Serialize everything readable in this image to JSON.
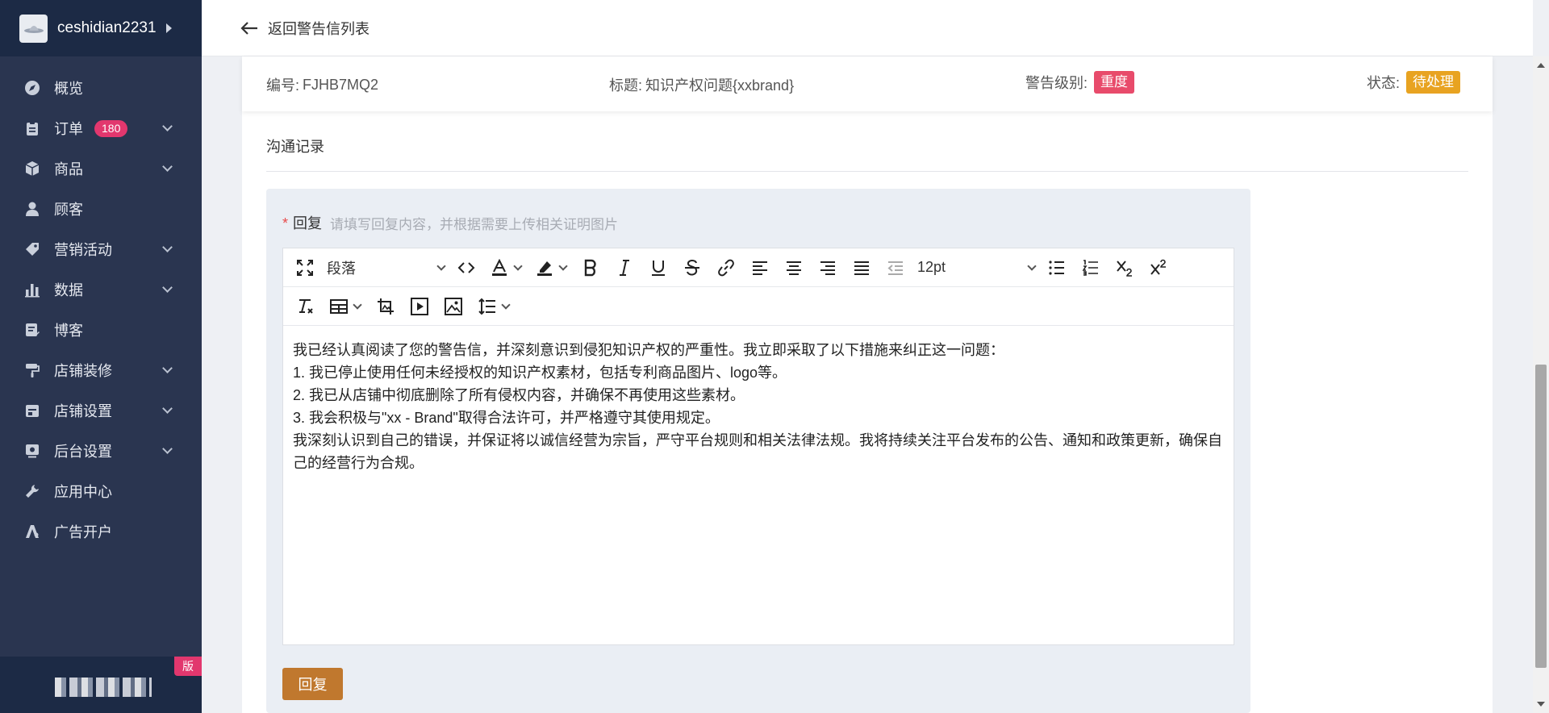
{
  "sidebar": {
    "username": "ceshidian2231",
    "version_tag": "版",
    "items": [
      {
        "label": "概览",
        "has_children": false
      },
      {
        "label": "订单",
        "has_children": true,
        "badge": "180"
      },
      {
        "label": "商品",
        "has_children": true
      },
      {
        "label": "顾客",
        "has_children": false
      },
      {
        "label": "营销活动",
        "has_children": true
      },
      {
        "label": "数据",
        "has_children": true
      },
      {
        "label": "博客",
        "has_children": false
      },
      {
        "label": "店铺装修",
        "has_children": true
      },
      {
        "label": "店铺设置",
        "has_children": true
      },
      {
        "label": "后台设置",
        "has_children": true
      },
      {
        "label": "应用中心",
        "has_children": false
      },
      {
        "label": "广告开户",
        "has_children": false
      }
    ]
  },
  "topbar": {
    "back_label": "返回警告信列表"
  },
  "info": {
    "code_label": "编号:",
    "code_value": "FJHB7MQ2",
    "title_label": "标题:",
    "title_value": "知识产权问题{xxbrand}",
    "level_label": "警告级别:",
    "level_value": "重度",
    "status_label": "状态:",
    "status_value": "待处理"
  },
  "section": {
    "title": "沟通记录"
  },
  "reply": {
    "label": "回复",
    "required_mark": "*",
    "hint": "请填写回复内容，并根据需要上传相关证明图片",
    "paragraph_select": "段落",
    "font_size_select": "12pt",
    "content_lines": [
      "我已经认真阅读了您的警告信，并深刻意识到侵犯知识产权的严重性。我立即采取了以下措施来纠正这一问题：",
      "1. 我已停止使用任何未经授权的知识产权素材，包括专利商品图片、logo等。",
      "2. 我已从店铺中彻底删除了所有侵权内容，并确保不再使用这些素材。",
      "3. 我会积极与\"xx - Brand\"取得合法许可，并严格遵守其使用规定。",
      "我深刻认识到自己的错误，并保证将以诚信经营为宗旨，严守平台规则和相关法律法规。我将持续关注平台发布的公告、通知和政策更新，确保自己的经营行为合规。"
    ],
    "submit_label": "回复"
  }
}
